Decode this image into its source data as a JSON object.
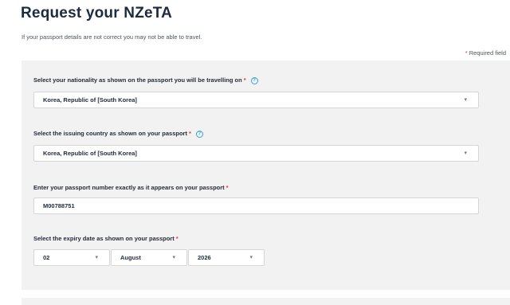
{
  "page": {
    "title": "Request your NZeTA",
    "intro": "If your passport details are not correct you may not be able to travel.",
    "required_star": "*",
    "required_text": "Required field"
  },
  "nationality": {
    "label": "Select your nationality as shown on the passport you will be travelling on",
    "star": "*",
    "help": "?",
    "value": "Korea, Republic of [South Korea]"
  },
  "issuing_country": {
    "label": "Select the issuing country as shown on your passport",
    "star": "*",
    "help": "?",
    "value": "Korea, Republic of [South Korea]"
  },
  "passport_number": {
    "label": "Enter your passport number exactly as it appears on your passport",
    "star": "*",
    "value": "M00788751"
  },
  "expiry": {
    "label": "Select the expiry date as shown on your passport",
    "star": "*",
    "day": "02",
    "month": "August",
    "year": "2026"
  },
  "icons": {
    "caret": "▾"
  }
}
